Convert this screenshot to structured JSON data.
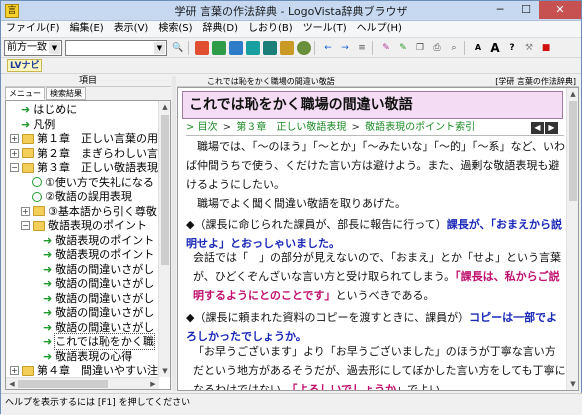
{
  "window": {
    "title": "学研 言葉の作法辞典 - LogoVista辞典ブラウザ",
    "minimize": "─",
    "maximize": "☐",
    "close": "✕"
  },
  "menu": [
    "ファイル(F)",
    "編集(E)",
    "表示(V)",
    "検索(S)",
    "辞典(D)",
    "しおり(B)",
    "ツール(T)",
    "ヘルプ(H)"
  ],
  "toolbar": {
    "search_mode": "前方一致",
    "search_value": "",
    "lv_label": "LVナビ"
  },
  "left_pane": {
    "header": "項目",
    "tabs": [
      "メニュー",
      "検索結果"
    ],
    "tree": [
      {
        "label": "はじめに",
        "icon": "green-arrow",
        "indent": 1
      },
      {
        "label": "凡例",
        "icon": "green-arrow",
        "indent": 1
      },
      {
        "label": "第１章　正しい言葉の用",
        "icon": "folder",
        "expander": "+",
        "indent": 0
      },
      {
        "label": "第２章　まぎらわしい言",
        "icon": "folder",
        "expander": "+",
        "indent": 0
      },
      {
        "label": "第３章　正しい敬語表現",
        "icon": "folder",
        "expander": "−",
        "indent": 0
      },
      {
        "label": "①使い方で失礼になる",
        "icon": "circle-arrow",
        "indent": 2
      },
      {
        "label": "②敬語の誤用表現",
        "icon": "circle-arrow",
        "indent": 2
      },
      {
        "label": "③基本語から引く尊敬",
        "icon": "folder",
        "expander": "+",
        "indent": 1
      },
      {
        "label": "敬語表現のポイント",
        "icon": "folder",
        "expander": "−",
        "indent": 1
      },
      {
        "label": "敬語表現のポイント",
        "icon": "green-arrow",
        "indent": 3
      },
      {
        "label": "敬語表現のポイント",
        "icon": "green-arrow",
        "indent": 3
      },
      {
        "label": "敬語の間違いさがし",
        "icon": "green-arrow",
        "indent": 3
      },
      {
        "label": "敬語の間違いさがし",
        "icon": "green-arrow",
        "indent": 3
      },
      {
        "label": "敬語の間違いさがし",
        "icon": "green-arrow",
        "indent": 3
      },
      {
        "label": "敬語の間違いさがし",
        "icon": "green-arrow",
        "indent": 3
      },
      {
        "label": "敬語の間違いさがし",
        "icon": "green-arrow",
        "indent": 3
      },
      {
        "label": "これでは恥をかく職",
        "icon": "green-arrow",
        "indent": 3,
        "selected": true
      },
      {
        "label": "敬語表現の心得",
        "icon": "green-arrow",
        "indent": 3
      },
      {
        "label": "第４章　間違いやすい注",
        "icon": "folder",
        "expander": "+",
        "indent": 0
      }
    ]
  },
  "right_pane": {
    "header_left": "これでは恥をかく職場の間違い敬語",
    "header_right": "[学研 言葉の作法辞典]",
    "title": "これでは恥をかく職場の間違い敬語",
    "breadcrumb": [
      "目次",
      "第３章　正しい敬語表現",
      "敬語表現のポイント索引"
    ],
    "breadcrumb_sep": ">",
    "nav_prev": "◀",
    "nav_next": "▶",
    "intro1": "職場では、「〜のほう」「〜とか」「〜みたいな」「〜的」「〜系」など、いわば仲間うちで使う、くだけた言い方は避けよう。また、過剰な敬語表現も避けるようにしたい。",
    "intro2": "職場でよく聞く間違い敬語を取りあげた。",
    "q1_lead": "◆（課長に命じられた課員が、部長に報告に行って）",
    "q1_bold": "課長が、「おまえから説明せよ」とおっしゃいました。",
    "a1_pre": "会話では「　」の部分が見えないので、「おまえ」とか「せよ」という言葉が、ひどくぞんざいな言い方と受け取られてしまう。",
    "a1_pink": "「課長は、私からご説明するようにとのことです」",
    "a1_post": "というべきである。",
    "q2_lead": "◆（課長に頼まれた資料のコピーを渡すときに、課員が）",
    "q2_bold": "コピーは一部でよろしかったでしょうか。",
    "a2_pre": "「お早うございます」より「お早うございました」のほうが丁寧な言い方だという地方があるそうだが、過去形にしてぼかした言い方をしても丁寧になるわけではない。",
    "a2_pink": "「よろしいでしょうか",
    "a2_post": "」でよい。"
  },
  "status": "ヘルプを表示するには [F1] を押してください"
}
